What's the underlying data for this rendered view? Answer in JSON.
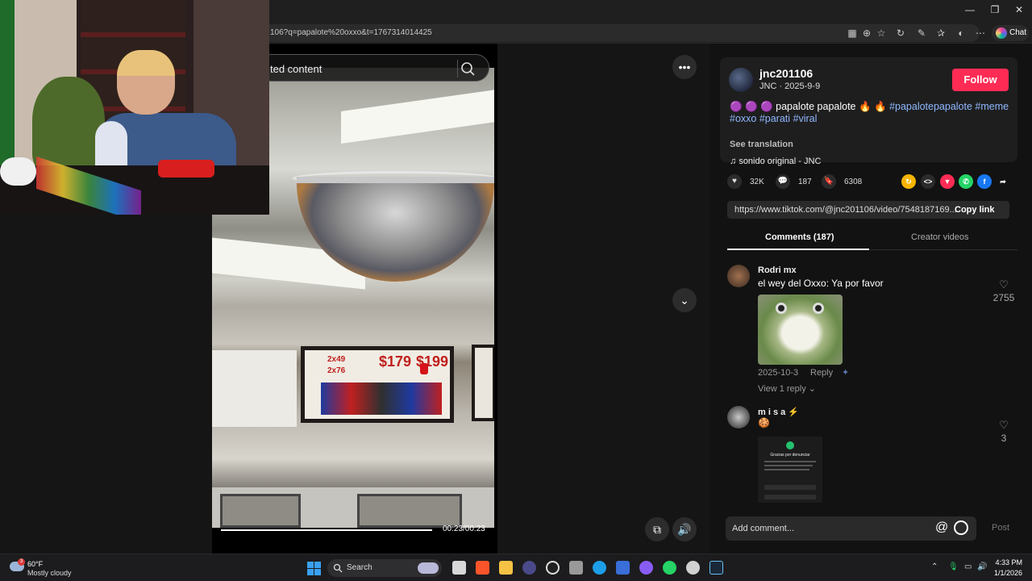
{
  "browser": {
    "url": "106?q=papalote%20oxxo&t=1767314014425",
    "chat_label": "Chat"
  },
  "video": {
    "search_text": "ted content",
    "time": "00:23/00:23",
    "progress": 1.0,
    "prices": [
      "$179",
      "$199"
    ],
    "small_prices": [
      "2x49",
      "2x76"
    ]
  },
  "post": {
    "username": "jnc201106",
    "meta": "JNC · 2025-9-9",
    "follow_label": "Follow",
    "desc_plain": "🟣 🟣 🟣 papalote papalote 🔥 🔥 ",
    "tags_line1": "#papalotepapalote #meme",
    "tags_line2": "#oxxo #parati #viral",
    "see_translation": "See translation",
    "sound": "sonido original - JNC",
    "likes": "32K",
    "comments": "187",
    "saves": "6308",
    "link": "https://www.tiktok.com/@jnc201106/video/7548187169...",
    "copy_link": "Copy link"
  },
  "tabs": {
    "comments": "Comments (187)",
    "creator": "Creator videos"
  },
  "comments": [
    {
      "user": "Rodri mx",
      "text": "el wey del Oxxo: Ya por favor",
      "date": "2025-10-3",
      "reply": "Reply",
      "view_replies": "View 1 reply",
      "likes": "2755"
    },
    {
      "user": "m i s a",
      "text": "🍪",
      "likes": "3",
      "image_title": "Gracias por denunciar"
    }
  ],
  "composer": {
    "placeholder": "Add comment...",
    "post": "Post"
  },
  "taskbar": {
    "temp": "60°F",
    "weather": "Mostly cloudy",
    "weather_badge": "3",
    "search": "Search",
    "time": "4:33 PM",
    "date": "1/1/2026"
  },
  "colors": {
    "follow": "#fe2c55",
    "hashtag": "#8fb8ff"
  }
}
